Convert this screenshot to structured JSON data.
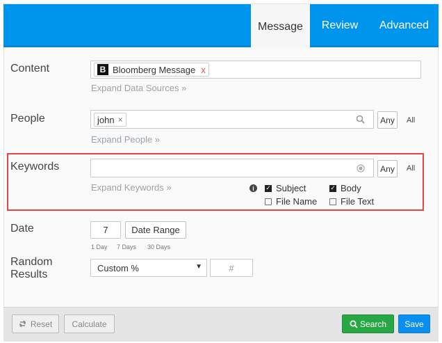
{
  "tabs": [
    {
      "label": "Message"
    },
    {
      "label": "Review"
    },
    {
      "label": "Advanced"
    }
  ],
  "content": {
    "label": "Content",
    "tag": "Bloomberg Message",
    "logo_letter": "B",
    "remove": "x",
    "expand": "Expand Data Sources »"
  },
  "people": {
    "label": "People",
    "tag": "john",
    "remove": "×",
    "any": "Any",
    "all": "All",
    "expand": "Expand People »"
  },
  "keywords": {
    "label": "Keywords",
    "value": "",
    "any": "Any",
    "all": "All",
    "expand": "Expand Keywords »",
    "info": "i",
    "options": [
      {
        "label": "Subject",
        "checked": true
      },
      {
        "label": "Body",
        "checked": true
      },
      {
        "label": "File Name",
        "checked": false
      },
      {
        "label": "File Text",
        "checked": false
      }
    ]
  },
  "date": {
    "label": "Date",
    "value": "7",
    "range_button": "Date Range",
    "quick": [
      "1 Day",
      "7 Days",
      "30 Days"
    ]
  },
  "random": {
    "label_line1": "Random",
    "label_line2": "Results",
    "select_value": "Custom %",
    "number_placeholder": "#"
  },
  "footer": {
    "reset": "Reset",
    "calculate": "Calculate",
    "search": "Search",
    "save": "Save"
  },
  "colors": {
    "header": "#0095ec",
    "highlight": "#e04848",
    "search": "#28a745",
    "save": "#0a8ff0"
  }
}
